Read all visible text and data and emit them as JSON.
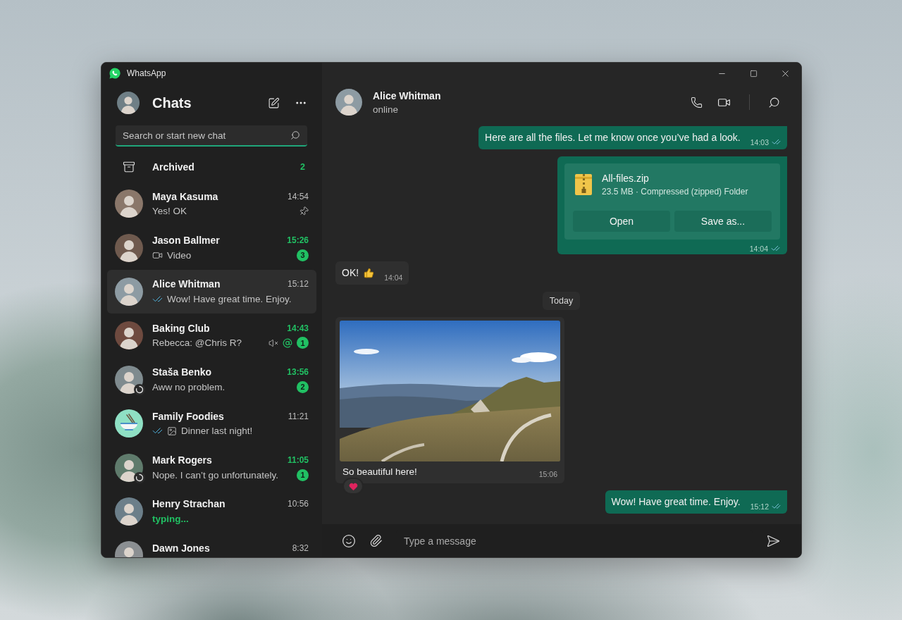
{
  "window": {
    "title": "WhatsApp"
  },
  "sidebar": {
    "title": "Chats",
    "search": {
      "placeholder": "Search or start new chat",
      "focused": true
    },
    "archived": {
      "label": "Archived",
      "count": "2"
    },
    "chats": [
      {
        "kind": "photo",
        "name": "Maya Kasuma",
        "time": "14:54",
        "preview": {
          "kind": "text",
          "text": "Yes! OK"
        },
        "selected": false,
        "pinned": true,
        "muted": false,
        "mentioned": false,
        "read_ticks": false,
        "status_ring": false
      },
      {
        "kind": "photo",
        "name": "Jason Ballmer",
        "time": "15:26",
        "preview": {
          "kind": "video",
          "text": "Video"
        },
        "badge": "3",
        "selected": false,
        "pinned": false,
        "muted": false,
        "mentioned": false,
        "read_ticks": false,
        "status_ring": false
      },
      {
        "kind": "photo",
        "name": "Alice Whitman",
        "time": "15:12",
        "preview": {
          "kind": "text",
          "text": "Wow! Have great time. Enjoy."
        },
        "selected": true,
        "pinned": false,
        "muted": false,
        "mentioned": false,
        "read_ticks": true,
        "status_ring": false
      },
      {
        "kind": "photo",
        "name": "Baking Club",
        "time": "14:43",
        "preview": {
          "kind": "text",
          "text": "Rebecca: @Chris R?"
        },
        "badge": "1",
        "selected": false,
        "pinned": false,
        "muted": true,
        "mentioned": true,
        "read_ticks": false,
        "status_ring": false
      },
      {
        "kind": "photo",
        "name": "Staša Benko",
        "time": "13:56",
        "preview": {
          "kind": "text",
          "text": "Aww no problem."
        },
        "badge": "2",
        "selected": false,
        "pinned": false,
        "muted": false,
        "mentioned": false,
        "read_ticks": false,
        "status_ring": true
      },
      {
        "kind": "icon",
        "name": "Family Foodies",
        "time": "11:21",
        "preview": {
          "kind": "photo",
          "text": "Dinner last night!"
        },
        "selected": false,
        "pinned": false,
        "muted": false,
        "mentioned": false,
        "read_ticks": true,
        "status_ring": false
      },
      {
        "kind": "photo",
        "name": "Mark Rogers",
        "time": "11:05",
        "preview": {
          "kind": "text",
          "text": "Nope. I can’t go unfortunately."
        },
        "badge": "1",
        "selected": false,
        "pinned": false,
        "muted": false,
        "mentioned": false,
        "read_ticks": false,
        "status_ring": true
      },
      {
        "kind": "photo",
        "name": "Henry Strachan",
        "time": "10:56",
        "preview": {
          "kind": "typing",
          "text": "typing..."
        },
        "selected": false,
        "pinned": false,
        "muted": false,
        "mentioned": false,
        "read_ticks": false,
        "status_ring": false
      },
      {
        "kind": "photo",
        "name": "Dawn Jones",
        "time": "8:32",
        "selected": false,
        "pinned": false,
        "muted": false,
        "mentioned": false,
        "status_ring": false
      }
    ]
  },
  "conversation": {
    "contact": {
      "name": "Alice Whitman",
      "status": "online"
    },
    "messages": [
      {
        "kind": "text_out",
        "text": "Here are all the files. Let me know once you’ve had a look.",
        "time": "14:03",
        "read": true
      },
      {
        "kind": "file_out",
        "file_name": "All-files.zip",
        "file_info": "23.5 MB · Compressed (zipped) Folder",
        "actions": [
          "Open",
          "Save as..."
        ],
        "time": "14:04",
        "read": true
      },
      {
        "kind": "text_in",
        "text": "OK!",
        "thumbs_up": true,
        "time": "14:04"
      },
      {
        "kind": "date",
        "text": "Today"
      },
      {
        "kind": "photo_in",
        "caption": "So beautiful here!",
        "time": "15:06",
        "heart_reaction": true
      },
      {
        "kind": "text_out",
        "text": "Wow! Have great time. Enjoy.",
        "time": "15:12",
        "read": true
      }
    ],
    "composer": {
      "placeholder": "Type a message"
    }
  }
}
